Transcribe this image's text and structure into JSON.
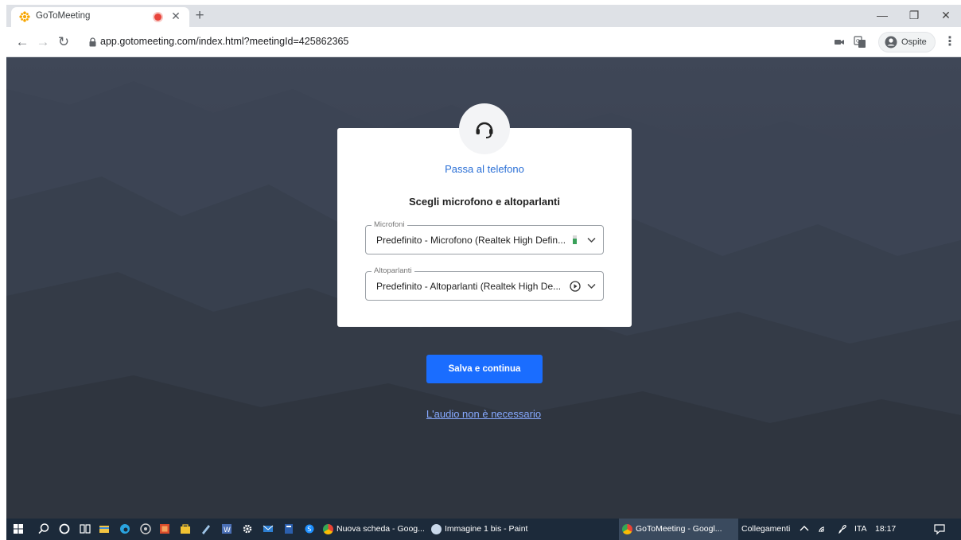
{
  "browser": {
    "tab_title": "GoToMeeting",
    "new_tab_symbol": "+",
    "url": "app.gotomeeting.com/index.html?meetingId=425862365",
    "profile_label": "Ospite",
    "icons": [
      "gotomeeting-favicon",
      "recording-dot-icon",
      "close-icon",
      "back-icon",
      "forward-icon",
      "reload-icon",
      "lock-icon",
      "camera-icon",
      "translate-icon",
      "profile-icon",
      "menu-icon"
    ]
  },
  "dialog": {
    "switch_to_phone": "Passa al telefono",
    "heading": "Scegli microfono e altoparlanti",
    "microphones": {
      "legend": "Microfoni",
      "value": "Predefinito - Microfono (Realtek High Defin...",
      "input_level": 0.6
    },
    "speakers": {
      "legend": "Altoparlanti",
      "value": "Predefinito - Altoparlanti (Realtek High De..."
    }
  },
  "actions": {
    "save_label": "Salva e continua",
    "no_audio_label": "L'audio non è necessario"
  },
  "colors": {
    "background": "#3b4352",
    "primary_button": "#1a6dff",
    "link": "#2a6fd6",
    "secondary_link": "#86a9ff"
  },
  "taskbar": {
    "apps": [
      {
        "label": "Nuova scheda - Goog...",
        "icon": "chrome-icon"
      },
      {
        "label": "Immagine 1 bis - Paint",
        "icon": "paint-icon"
      },
      {
        "label": "GoToMeeting - Googl...",
        "icon": "chrome-icon"
      }
    ],
    "links_label": "Collegamenti",
    "language": "ITA",
    "time": "18:17"
  }
}
